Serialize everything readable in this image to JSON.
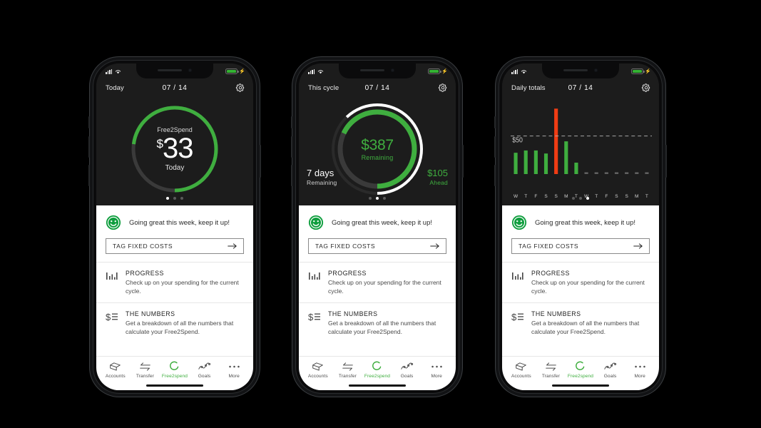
{
  "theme": {
    "green": "#3fae3f",
    "bright_green": "#34b233",
    "red": "#f03c14",
    "dark_bg": "#1c1c1c",
    "track_gray": "#3a3a3a",
    "white": "#ffffff"
  },
  "phones": [
    {
      "id": "phone-today",
      "status": {
        "carrier_bars": 4,
        "wifi": "wifi-icon",
        "battery": "battery-icon",
        "charging": "bolt-icon"
      },
      "header": {
        "label": "Today",
        "date": "07 / 14",
        "settings_icon": "gear-icon"
      },
      "hero": {
        "type": "ring-single",
        "ring": {
          "value_percent": 73,
          "color": "#3fae3f",
          "track": "#3a3a3a"
        },
        "caption_top": "Free2Spend",
        "currency": "$",
        "amount": "33",
        "caption_bottom": "Today"
      },
      "page_dots": {
        "count": 3,
        "active": 0
      }
    },
    {
      "id": "phone-cycle",
      "status": {
        "carrier_bars": 4,
        "wifi": "wifi-icon",
        "battery": "battery-icon",
        "charging": "bolt-icon"
      },
      "header": {
        "label": "This cycle",
        "date": "07 / 14",
        "settings_icon": "gear-icon"
      },
      "hero": {
        "type": "ring-double",
        "inner_ring": {
          "value_percent": 68,
          "color": "#3fae3f",
          "track": "#3a3a3a"
        },
        "outer_ring": {
          "value_percent": 62,
          "color": "#ffffff",
          "track": "#2a2a2a"
        },
        "amount": "$387",
        "amount_sub": "Remaining",
        "left_stat": {
          "value": "7 days",
          "label": "Remaining"
        },
        "right_stat": {
          "value": "$105",
          "label": "Ahead"
        }
      },
      "page_dots": {
        "count": 3,
        "active": 1
      }
    },
    {
      "id": "phone-daily",
      "status": {
        "carrier_bars": 4,
        "wifi": "wifi-icon",
        "battery": "battery-icon",
        "charging": "bolt-icon"
      },
      "header": {
        "label": "Daily totals",
        "date": "07 / 14",
        "settings_icon": "gear-icon"
      },
      "hero": {
        "type": "bar-chart"
      },
      "page_dots": {
        "count": 3,
        "active": 2
      }
    }
  ],
  "chart_data": {
    "type": "bar",
    "title": "Daily totals",
    "threshold_label": "$50",
    "threshold_value": 50,
    "ylim": [
      0,
      90
    ],
    "xlabel": "",
    "ylabel": "",
    "grid": false,
    "legend": null,
    "categories": [
      "W",
      "T",
      "F",
      "S",
      "S",
      "M",
      "T",
      "W",
      "T",
      "F",
      "S",
      "S",
      "M",
      "T"
    ],
    "values": [
      28,
      31,
      31,
      27,
      86,
      43,
      15,
      0,
      0,
      0,
      0,
      0,
      0,
      0
    ],
    "bar_colors": [
      "#3fae3f",
      "#3fae3f",
      "#3fae3f",
      "#3fae3f",
      "#f03c14",
      "#3fae3f",
      "#3fae3f",
      "#555555",
      "#555555",
      "#555555",
      "#555555",
      "#555555",
      "#555555",
      "#555555"
    ],
    "future_placeholder": "dash",
    "annotations": [
      {
        "text": "$50",
        "type": "threshold-line",
        "style": "dashed",
        "color": "#b8b8b8"
      }
    ]
  },
  "sheet": {
    "greeting": {
      "icon": "smiley-icon",
      "text": "Going great this week, keep it up!"
    },
    "tag_button": {
      "label": "TAG FIXED COSTS",
      "icon": "arrow-right-icon"
    },
    "rows": [
      {
        "icon": "bar-chart-icon",
        "title": "PROGRESS",
        "desc": "Check up on your spending for the current cycle."
      },
      {
        "icon": "dollar-list-icon",
        "title": "THE NUMBERS",
        "desc": "Get a breakdown of all the numbers that calculate your Free2Spend."
      }
    ],
    "tabs": [
      {
        "icon": "accounts-icon",
        "label": "Accounts",
        "active": false
      },
      {
        "icon": "transfer-icon",
        "label": "Transfer",
        "active": false
      },
      {
        "icon": "free2spend-icon",
        "label": "Free2spend",
        "active": true
      },
      {
        "icon": "goals-icon",
        "label": "Goals",
        "active": false
      },
      {
        "icon": "more-icon",
        "label": "More",
        "active": false
      }
    ]
  }
}
